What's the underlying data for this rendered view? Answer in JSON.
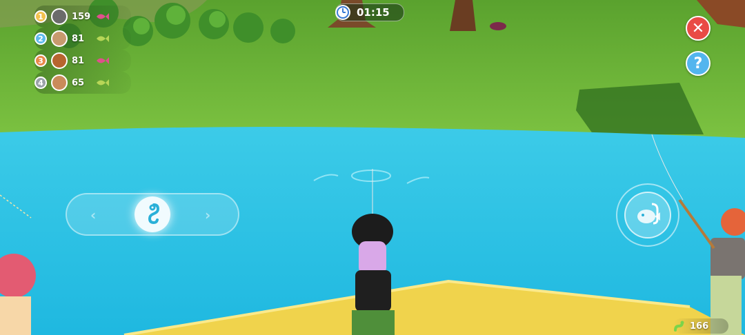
{
  "leaderboard": [
    {
      "rank": "1",
      "score": "159",
      "rank_color": "#f2c14e",
      "avatar_color": "#6b6b6b",
      "fish_color": "#e0508c"
    },
    {
      "rank": "2",
      "score": "81",
      "rank_color": "#5fb9ec",
      "avatar_color": "#c79a6e",
      "fish_color": "#b7d657"
    },
    {
      "rank": "3",
      "score": "81",
      "rank_color": "#e8884a",
      "avatar_color": "#b7652f",
      "fish_color": "#e0508c"
    },
    {
      "rank": "4",
      "score": "65",
      "rank_color": "#9aa1a8",
      "avatar_color": "#c98b5a",
      "fish_color": "#b7d657"
    }
  ],
  "timer": {
    "value": "01:15",
    "icon": "clock-icon"
  },
  "buttons": {
    "close_icon": "close-icon",
    "help_icon": "question-icon",
    "close_glyph": "✕",
    "help_glyph": "?"
  },
  "controls": {
    "left_chevron": "‹",
    "right_chevron": "›",
    "reel_icon": "hook-icon",
    "cast_icon": "fish-hook-icon"
  },
  "bait": {
    "count": "166",
    "icon": "worm-icon"
  },
  "colors": {
    "water": "#2ec3e4",
    "grass": "#6fb83a",
    "sand": "#f0d34c",
    "close": "#e94b45",
    "help": "#53b5ee"
  }
}
